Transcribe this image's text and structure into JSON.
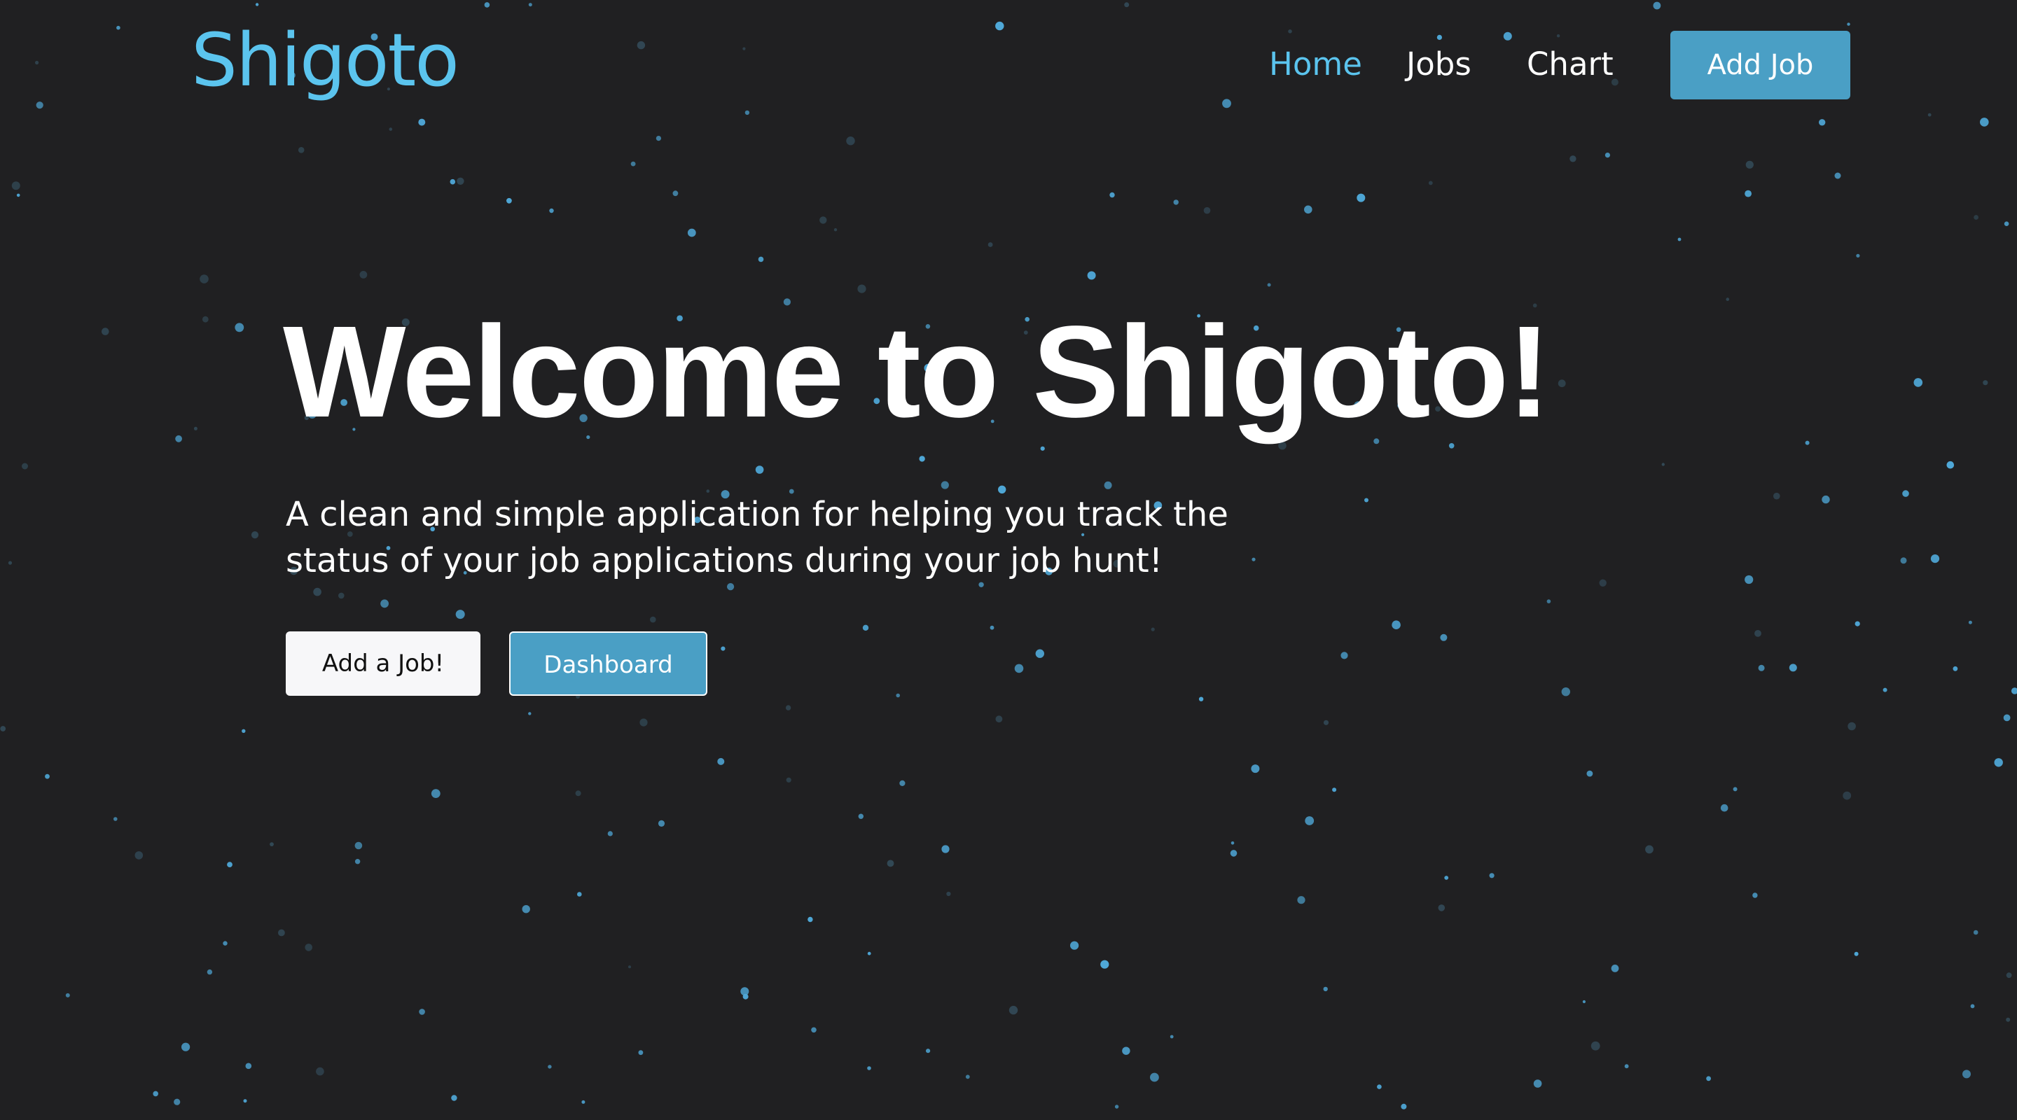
{
  "theme": {
    "background": "#202022",
    "brand_color": "#5bc4ee",
    "nav_active_color": "#5bc4ee",
    "nav_text_color": "#ffffff",
    "accent_button_bg": "#4a9fc5",
    "light_button_bg": "#f7f7f9",
    "light_button_text": "#111111",
    "star_color": "#4fa8d8"
  },
  "navbar": {
    "brand": "Shigoto",
    "links": [
      {
        "label": "Home",
        "active": true
      },
      {
        "label": "Jobs",
        "active": false
      },
      {
        "label": "Chart",
        "active": false
      }
    ],
    "add_job_label": "Add Job"
  },
  "hero": {
    "title": "Welcome to Shigoto!",
    "subtitle": "A clean and simple application for helping you track the status of your job applications during your job hunt!",
    "primary_button": "Add a Job!",
    "secondary_button": "Dashboard"
  }
}
